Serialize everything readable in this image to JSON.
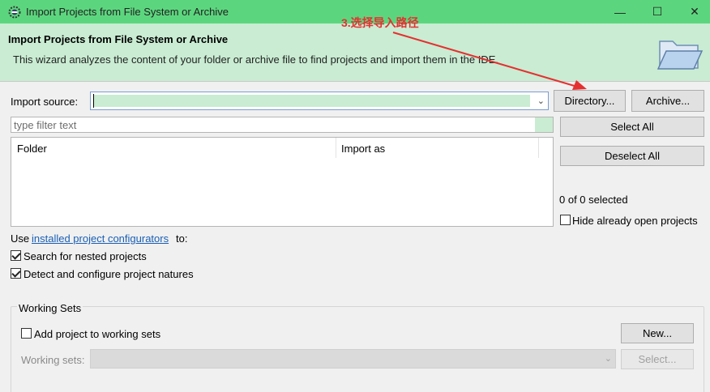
{
  "window": {
    "title": "Import Projects from File System or Archive",
    "minimize": "—",
    "maximize": "☐",
    "close": "✕"
  },
  "banner": {
    "title": "Import Projects from File System or Archive",
    "description": "This wizard analyzes the content of your folder or archive file to find projects and import them in the IDE."
  },
  "import_source": {
    "label": "Import source:",
    "value": "",
    "directory_button": "Directory...",
    "archive_button": "Archive..."
  },
  "filter": {
    "placeholder": "type filter text"
  },
  "selection": {
    "select_all": "Select All",
    "deselect_all": "Deselect All",
    "count": "0 of 0 selected",
    "hide_open_label": "Hide already open projects",
    "hide_open_checked": false
  },
  "table": {
    "columns": [
      "Folder",
      "Import as"
    ]
  },
  "configurators": {
    "prefix": "Use",
    "link": "installed project configurators",
    "suffix": "to:"
  },
  "options": {
    "nested_label": "Search for nested projects",
    "nested_checked": true,
    "natures_label": "Detect and configure project natures",
    "natures_checked": true
  },
  "working_sets": {
    "group_label": "Working Sets",
    "add_label": "Add project to working sets",
    "add_checked": false,
    "new_button": "New...",
    "sets_label": "Working sets:",
    "select_button": "Select..."
  },
  "annotation": {
    "text": "3.选择导入路径",
    "color": "#e53030"
  }
}
